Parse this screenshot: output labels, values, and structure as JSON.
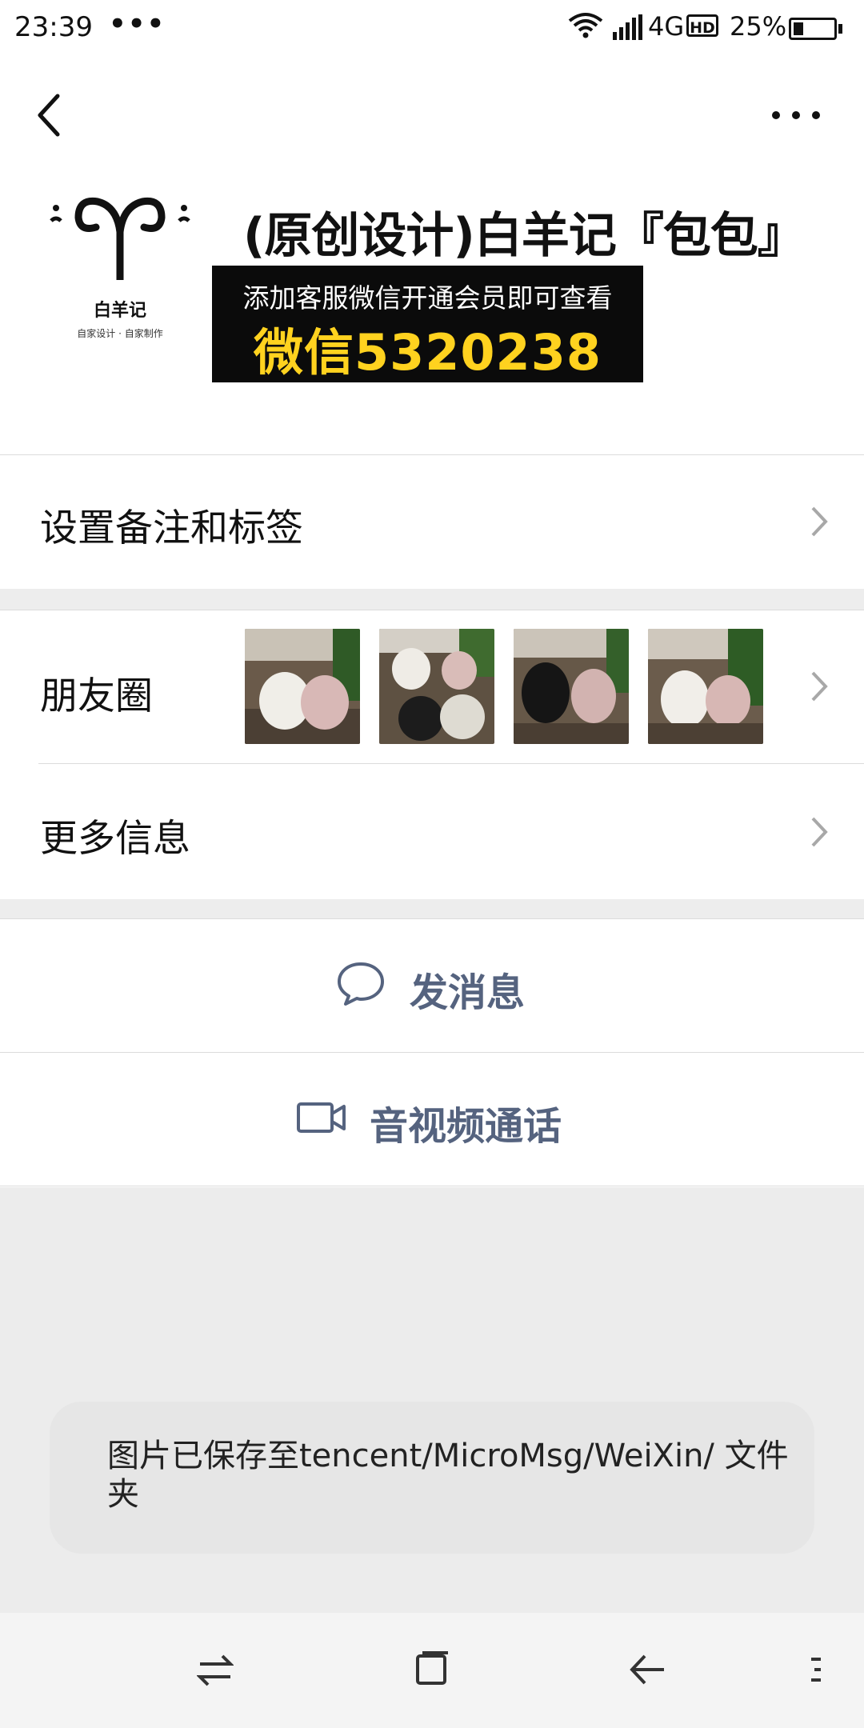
{
  "status_bar": {
    "time": "23:39",
    "dots": "•••",
    "network": "4G",
    "hd": "HD",
    "battery_percent": "25%",
    "battery_level": 0.25
  },
  "header": {
    "back_icon": "chevron-left-icon",
    "more_icon": "more-horizontal-icon"
  },
  "profile": {
    "logo_name": "白羊记",
    "logo_sub": "自家设计 · 自家制作",
    "title": "(原创设计)白羊记『包包』"
  },
  "overlay": {
    "line1": "添加客服微信开通会员即可查看",
    "line2": "微信5320238"
  },
  "rows": {
    "remarks": "设置备注和标签",
    "moments": "朋友圈",
    "more_info": "更多信息"
  },
  "moments_thumbs": [
    "bag-photo-1",
    "bag-photo-2",
    "bag-photo-3",
    "bag-photo-4"
  ],
  "actions": {
    "message": "发消息",
    "message_icon": "chat-bubble-icon",
    "video_call": "音视频通话",
    "video_icon": "video-camera-icon"
  },
  "toast": {
    "text": "图片已保存至tencent/MicroMsg/WeiXin/ 文件夹"
  },
  "nav": {
    "icons": [
      "switch-arrows-icon",
      "home-square-icon",
      "back-arrow-icon",
      "menu-icon"
    ]
  },
  "colors": {
    "accent_text": "#55637f",
    "banner_bg": "#0b0b0b",
    "banner_highlight": "#ffd21f",
    "separator_bg": "#ededed"
  }
}
